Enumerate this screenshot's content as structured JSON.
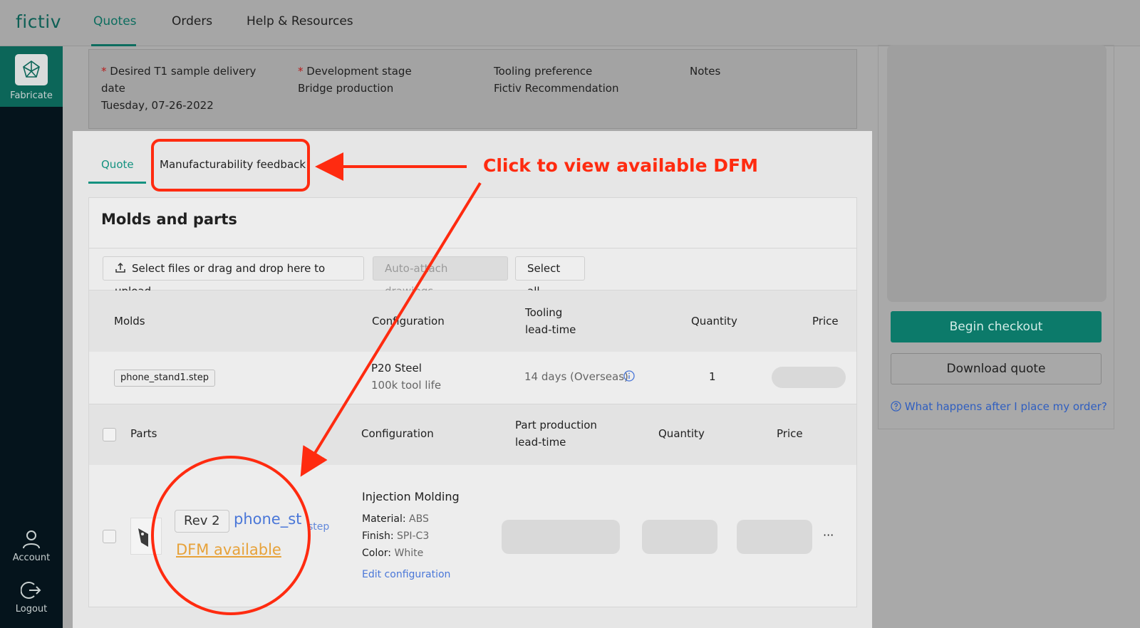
{
  "header": {
    "logo": "fictiv",
    "nav": [
      "Quotes",
      "Orders",
      "Help & Resources"
    ]
  },
  "sidebar": {
    "fabricate": "Fabricate",
    "account": "Account",
    "logout": "Logout"
  },
  "project": {
    "delivery_label_1": "Desired T1 sample delivery",
    "delivery_label_2": "date",
    "delivery_value": "Tuesday, 07-26-2022",
    "stage_label": "Development stage",
    "stage_value": "Bridge production",
    "tooling_label": "Tooling preference",
    "tooling_value": "Fictiv Recommendation",
    "notes_label": "Notes",
    "required_mark": "*"
  },
  "tabs": {
    "quote": "Quote",
    "feedback": "Manufacturability feedback"
  },
  "molds_card": {
    "title": "Molds and parts",
    "upload": "Select files or drag and drop here to upload",
    "auto_attach": "Auto-attach drawings",
    "select_all": "Select all"
  },
  "molds_table": {
    "headers": {
      "molds": "Molds",
      "configuration": "Configuration",
      "tooling_1": "Tooling",
      "tooling_2": "lead-time",
      "quantity": "Quantity",
      "price": "Price"
    },
    "row": {
      "file": "phone_stand1.step",
      "material": "P20 Steel",
      "life": "100k tool life",
      "lead_time": "14 days (Overseas)",
      "quantity": "1"
    }
  },
  "parts_table": {
    "headers": {
      "parts": "Parts",
      "configuration": "Configuration",
      "lead_1": "Part production",
      "lead_2": "lead-time",
      "quantity": "Quantity",
      "price": "Price"
    },
    "row": {
      "rev": "Rev 2",
      "name": "phone_st",
      "ext": "step",
      "dfm": "DFM available",
      "process": "Injection Molding",
      "material_label": "Material:",
      "material": "ABS",
      "finish_label": "Finish:",
      "finish": "SPI-C3",
      "color_label": "Color:",
      "color": "White",
      "edit": "Edit configuration",
      "more": "···"
    }
  },
  "right_panel": {
    "checkout": "Begin checkout",
    "download": "Download quote",
    "help": "What happens after I place my order?"
  },
  "annotation": {
    "text": "Click to view available DFM",
    "color": "#ff2b10"
  }
}
